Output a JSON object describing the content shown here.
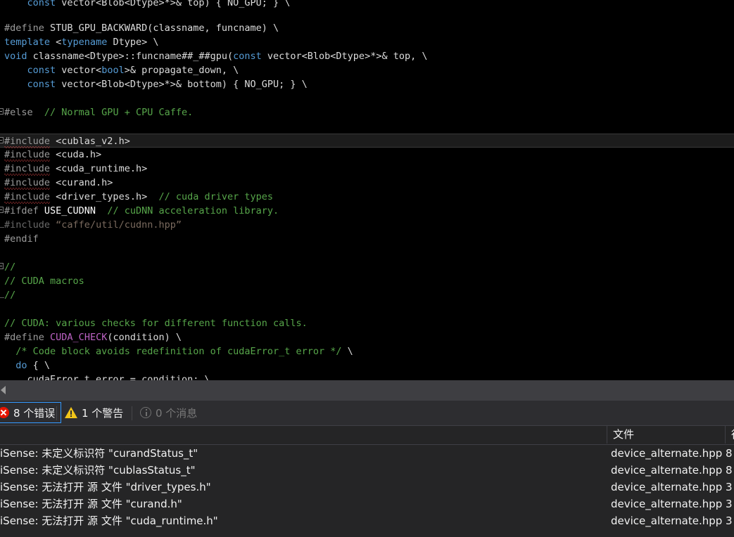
{
  "editor": {
    "lines": [
      {
        "fold": "none",
        "clipped_top": true,
        "tokens": [
          {
            "t": "    ",
            "c": "t-plain"
          },
          {
            "t": "const",
            "c": "t-kw"
          },
          {
            "t": " vector<Blob<Dtype>*>& top) { NO_GPU; } \\",
            "c": "t-plain"
          }
        ]
      },
      {
        "fold": "none",
        "tokens": []
      },
      {
        "fold": "none",
        "tokens": [
          {
            "t": "#define",
            "c": "t-pre"
          },
          {
            "t": " STUB_GPU_BACKWARD(classname, funcname) \\",
            "c": "t-plain"
          }
        ]
      },
      {
        "fold": "none",
        "tokens": [
          {
            "t": "template",
            "c": "t-kw"
          },
          {
            "t": " <",
            "c": "t-plain"
          },
          {
            "t": "typename",
            "c": "t-kw"
          },
          {
            "t": " Dtype> \\",
            "c": "t-plain"
          }
        ]
      },
      {
        "fold": "none",
        "tokens": [
          {
            "t": "void",
            "c": "t-kw"
          },
          {
            "t": " classname<Dtype>::funcname##_##gpu(",
            "c": "t-plain"
          },
          {
            "t": "const",
            "c": "t-kw"
          },
          {
            "t": " vector<Blob<Dtype>*>& top, \\",
            "c": "t-plain"
          }
        ]
      },
      {
        "fold": "none",
        "tokens": [
          {
            "t": "    ",
            "c": "t-plain"
          },
          {
            "t": "const",
            "c": "t-kw"
          },
          {
            "t": " vector<",
            "c": "t-plain"
          },
          {
            "t": "bool",
            "c": "t-kw"
          },
          {
            "t": ">& propagate_down, \\",
            "c": "t-plain"
          }
        ]
      },
      {
        "fold": "none",
        "tokens": [
          {
            "t": "    ",
            "c": "t-plain"
          },
          {
            "t": "const",
            "c": "t-kw"
          },
          {
            "t": " vector<Blob<Dtype>*>& bottom) { NO_GPU; } \\",
            "c": "t-plain"
          }
        ]
      },
      {
        "fold": "none",
        "tokens": []
      },
      {
        "fold": "start",
        "tokens": [
          {
            "t": "#else",
            "c": "t-pre"
          },
          {
            "t": "  ",
            "c": "t-plain"
          },
          {
            "t": "// Normal GPU + CPU Caffe.",
            "c": "t-com"
          }
        ]
      },
      {
        "fold": "none",
        "tokens": []
      },
      {
        "fold": "start",
        "current": true,
        "tokens": [
          {
            "t": "#include",
            "c": "t-pre",
            "squiggle": true
          },
          {
            "t": " <cublas_v2.h>",
            "c": "t-plain"
          }
        ]
      },
      {
        "fold": "none",
        "tokens": [
          {
            "t": "#include",
            "c": "t-pre",
            "squiggle": true
          },
          {
            "t": " <cuda.h>",
            "c": "t-plain"
          }
        ]
      },
      {
        "fold": "none",
        "tokens": [
          {
            "t": "#include",
            "c": "t-pre",
            "squiggle": true
          },
          {
            "t": " <cuda_runtime.h>",
            "c": "t-plain"
          }
        ]
      },
      {
        "fold": "none",
        "tokens": [
          {
            "t": "#include",
            "c": "t-pre",
            "squiggle": true
          },
          {
            "t": " <curand.h>",
            "c": "t-plain"
          }
        ]
      },
      {
        "fold": "none",
        "tokens": [
          {
            "t": "#include",
            "c": "t-pre",
            "squiggle": true
          },
          {
            "t": " <driver_types.h>",
            "c": "t-plain"
          },
          {
            "t": "  // cuda driver types",
            "c": "t-com"
          }
        ]
      },
      {
        "fold": "start",
        "foldend": true,
        "tokens": [
          {
            "t": "#ifdef",
            "c": "t-pre"
          },
          {
            "t": " USE_CUDNN",
            "c": "t-white"
          },
          {
            "t": "  // cuDNN acceleration library.",
            "c": "t-com"
          }
        ]
      },
      {
        "fold": "endline",
        "tokens": [
          {
            "t": "#include",
            "c": "t-dim"
          },
          {
            "t": " ",
            "c": "t-plain"
          },
          {
            "t": "“caffe/util/cudnn.hpp”",
            "c": "t-dimstr"
          }
        ]
      },
      {
        "fold": "none",
        "tokens": [
          {
            "t": "#endif",
            "c": "t-pre"
          }
        ]
      },
      {
        "fold": "none",
        "tokens": []
      },
      {
        "fold": "start",
        "tokens": [
          {
            "t": "//",
            "c": "t-com"
          }
        ]
      },
      {
        "fold": "none",
        "tokens": [
          {
            "t": "// CUDA macros",
            "c": "t-com"
          }
        ]
      },
      {
        "fold": "endline",
        "tokens": [
          {
            "t": "//",
            "c": "t-com"
          }
        ]
      },
      {
        "fold": "none",
        "tokens": []
      },
      {
        "fold": "none",
        "tokens": [
          {
            "t": "// CUDA: various checks for different function calls.",
            "c": "t-com"
          }
        ]
      },
      {
        "fold": "none",
        "tokens": [
          {
            "t": "#define",
            "c": "t-pre"
          },
          {
            "t": " ",
            "c": "t-plain"
          },
          {
            "t": "CUDA_CHECK",
            "c": "t-macro"
          },
          {
            "t": "(condition) \\",
            "c": "t-plain"
          }
        ]
      },
      {
        "fold": "none",
        "tokens": [
          {
            "t": "  ",
            "c": "t-plain"
          },
          {
            "t": "/* Code block avoids redefinition of cudaError_t error */",
            "c": "t-com"
          },
          {
            "t": " \\",
            "c": "t-plain"
          }
        ]
      },
      {
        "fold": "none",
        "tokens": [
          {
            "t": "  ",
            "c": "t-plain"
          },
          {
            "t": "do",
            "c": "t-kw"
          },
          {
            "t": " { \\",
            "c": "t-plain"
          }
        ]
      },
      {
        "fold": "none",
        "clipped_bottom": true,
        "tokens": [
          {
            "t": "    cudaError_t error = condition; \\",
            "c": "t-plain"
          }
        ]
      }
    ],
    "hscroll": {
      "arrow_icon": "scroll-left-arrow"
    }
  },
  "error_list": {
    "toolbar": {
      "errors": {
        "icon": "error-icon",
        "label": "8 个错误",
        "selected": true
      },
      "warnings": {
        "icon": "warning-icon",
        "label": "1 个警告",
        "selected": false
      },
      "messages": {
        "icon": "info-icon",
        "label": "0 个消息",
        "selected": false
      }
    },
    "columns": [
      {
        "key": "description",
        "label": ""
      },
      {
        "key": "file",
        "label": "文件"
      },
      {
        "key": "line",
        "label": "行"
      }
    ],
    "rows": [
      {
        "description": "iSense: 未定义标识符 \"curandStatus_t\"",
        "file": "device_alternate.hpp",
        "line": "8"
      },
      {
        "description": "iSense: 未定义标识符 \"cublasStatus_t\"",
        "file": "device_alternate.hpp",
        "line": "8"
      },
      {
        "description": "iSense: 无法打开 源 文件 \"driver_types.h\"",
        "file": "device_alternate.hpp",
        "line": "3"
      },
      {
        "description": "iSense: 无法打开 源 文件 \"curand.h\"",
        "file": "device_alternate.hpp",
        "line": "3"
      },
      {
        "description": "iSense: 无法打开 源 文件 \"cuda_runtime.h\"",
        "file": "device_alternate.hpp",
        "line": "3"
      }
    ]
  },
  "colors": {
    "editor_bg": "#000000",
    "panel_bg": "#2d2d30",
    "grid_bg": "#252526",
    "accent_selection": "#3399ff",
    "error_red": "#e51400",
    "warning_yellow": "#f0c419",
    "comment_green": "#57a64a",
    "keyword_blue": "#569cd6",
    "macro_purple": "#bd63c5",
    "squiggle_red": "#c23b3b"
  }
}
